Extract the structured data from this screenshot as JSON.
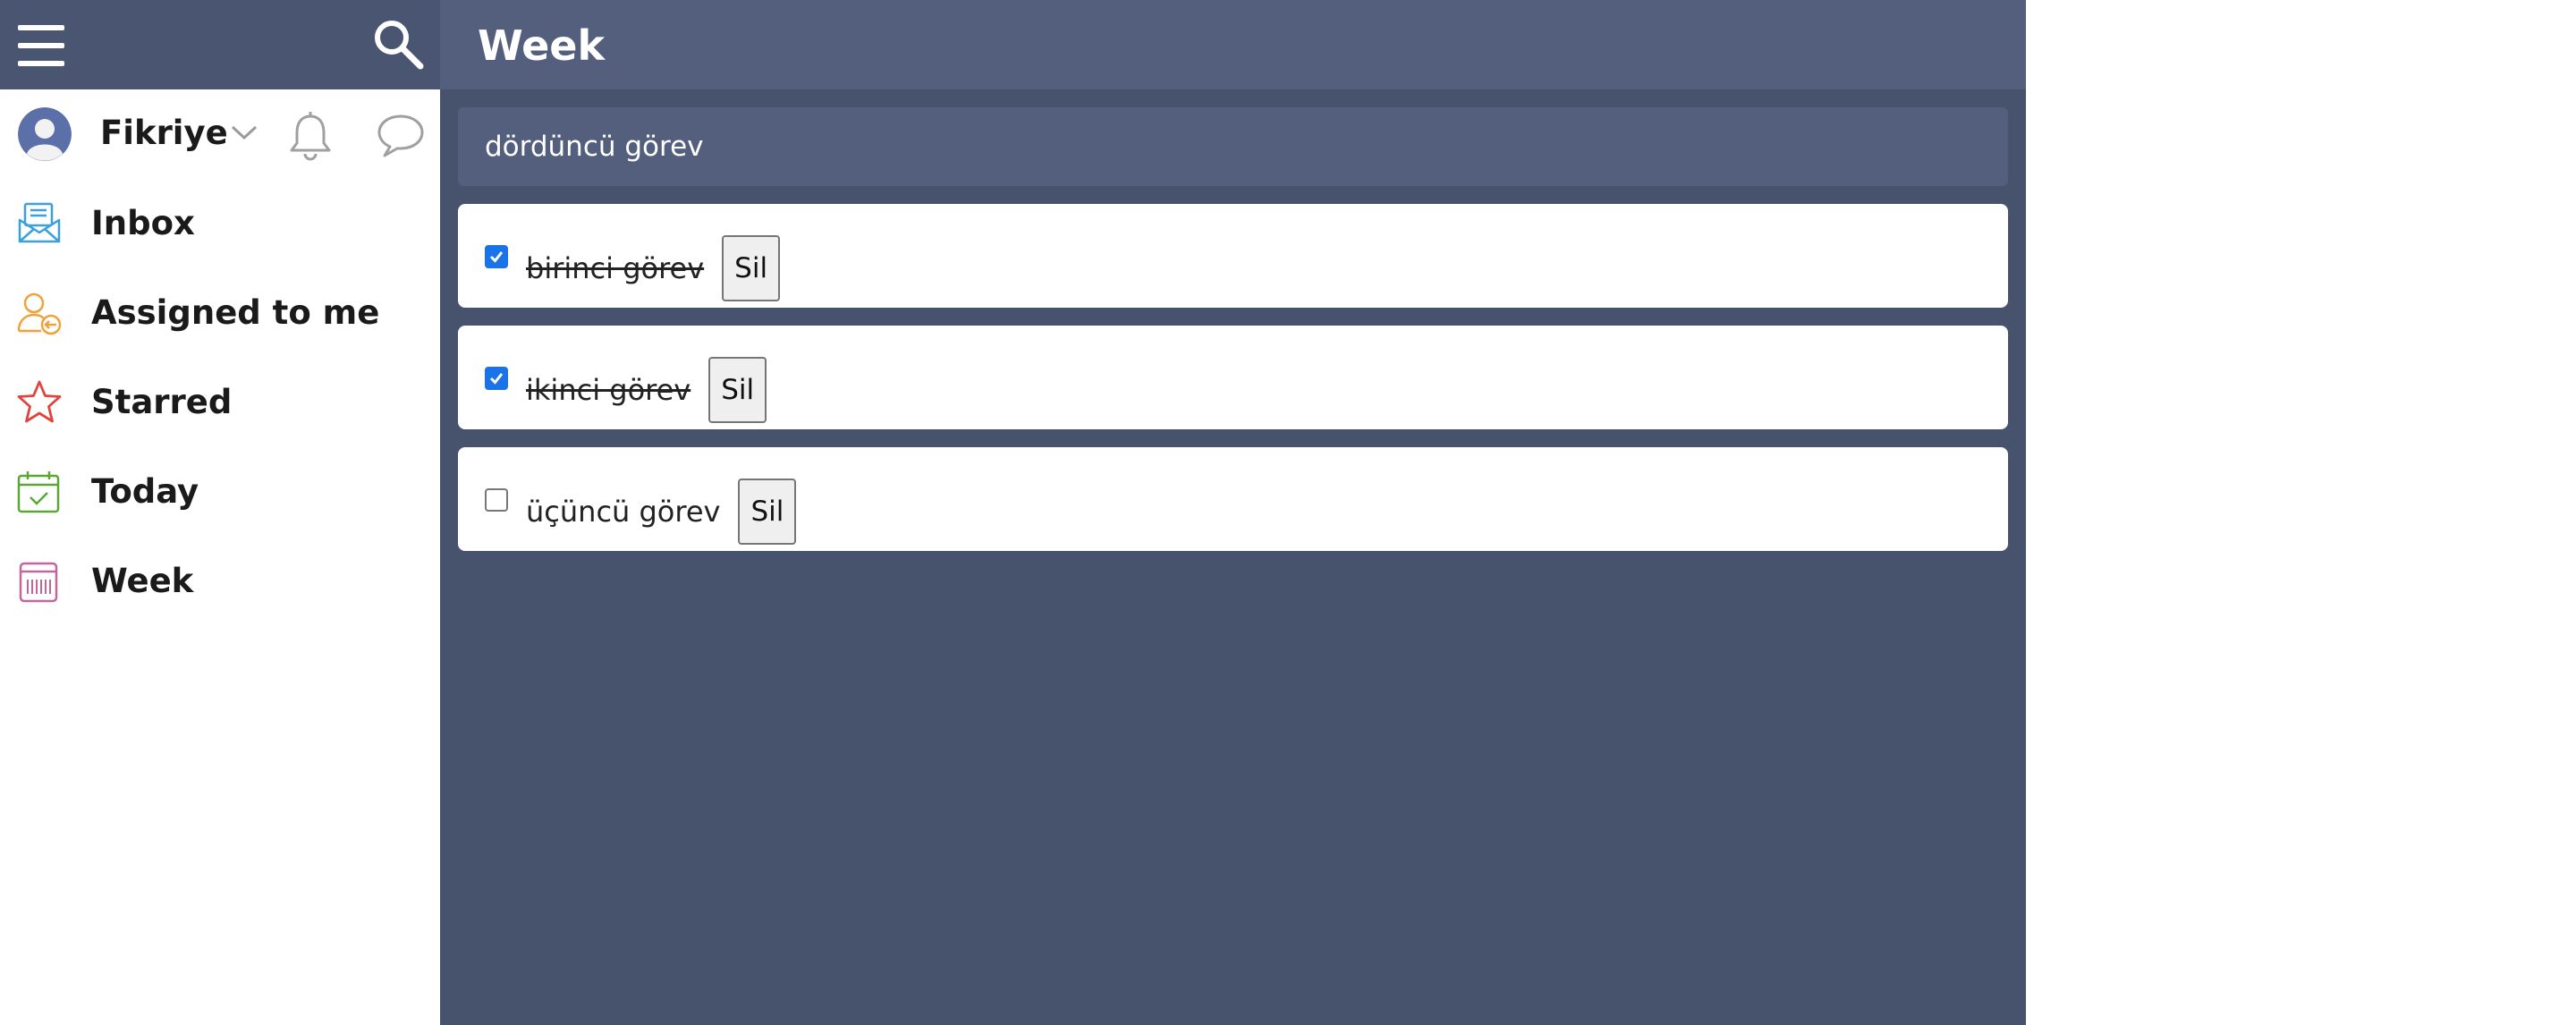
{
  "header": {
    "title": "Week"
  },
  "user": {
    "name": "Fikriye"
  },
  "sidebar": {
    "items": [
      {
        "label": "Inbox",
        "icon": "inbox-icon",
        "color": "#3b9fe0"
      },
      {
        "label": "Assigned to me",
        "icon": "assigned-user-icon",
        "color": "#f0a23a"
      },
      {
        "label": "Starred",
        "icon": "star-icon",
        "color": "#e0443e"
      },
      {
        "label": "Today",
        "icon": "calendar-check-icon",
        "color": "#5aa832"
      },
      {
        "label": "Week",
        "icon": "calendar-week-icon",
        "color": "#c1669e"
      }
    ]
  },
  "new_task": {
    "value": "dördüncü görev",
    "placeholder": ""
  },
  "tasks": [
    {
      "text": "birinci görev",
      "done": true,
      "delete_label": "Sil"
    },
    {
      "text": "ikinci görev",
      "done": true,
      "delete_label": "Sil"
    },
    {
      "text": "üçüncü görev",
      "done": false,
      "delete_label": "Sil"
    }
  ],
  "colors": {
    "sidebar_header": "#4a5571",
    "main_background": "#47536c",
    "main_header": "#545f7e",
    "checkbox_checked": "#1a73e8"
  }
}
